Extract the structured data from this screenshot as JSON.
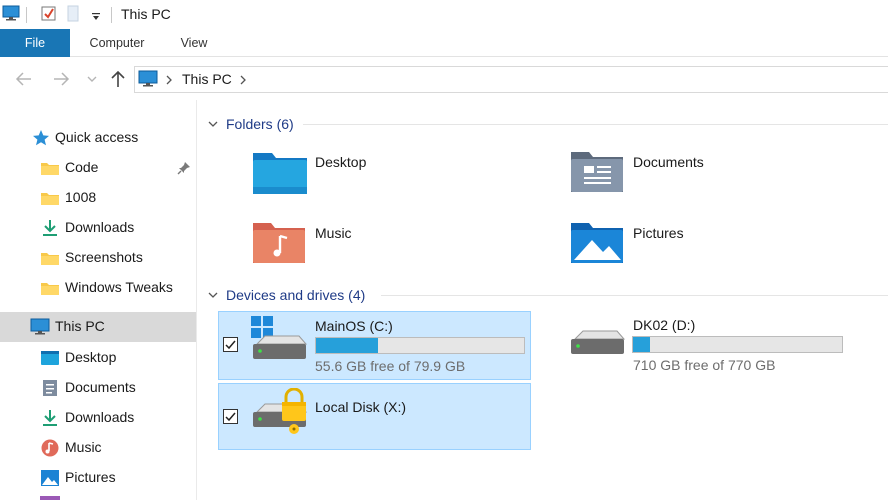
{
  "window": {
    "title": "This PC"
  },
  "ribbon": {
    "tabs": [
      {
        "label": "File"
      },
      {
        "label": "Computer"
      },
      {
        "label": "View"
      }
    ]
  },
  "address": {
    "path": "This PC"
  },
  "sidebar": {
    "quick_access_label": "Quick access",
    "quick_items": [
      {
        "label": "Code",
        "pinned": true
      },
      {
        "label": "1008"
      },
      {
        "label": "Downloads"
      },
      {
        "label": "Screenshots"
      },
      {
        "label": "Windows Tweaks"
      }
    ],
    "this_pc_label": "This PC",
    "pc_items": [
      {
        "label": "Desktop"
      },
      {
        "label": "Documents"
      },
      {
        "label": "Downloads"
      },
      {
        "label": "Music"
      },
      {
        "label": "Pictures"
      }
    ]
  },
  "folders": {
    "header": "Folders (6)",
    "items": [
      {
        "label": "Desktop"
      },
      {
        "label": "Documents"
      },
      {
        "label": "Music"
      },
      {
        "label": "Pictures"
      }
    ]
  },
  "drives": {
    "header": "Devices and drives (4)",
    "items": [
      {
        "label": "MainOS (C:)",
        "free": "55.6 GB free of 79.9 GB",
        "used_fraction": 0.3
      },
      {
        "label": "DK02 (D:)",
        "free": "710 GB free of 770 GB",
        "used_fraction": 0.08
      },
      {
        "label": "Local Disk (X:)"
      }
    ]
  },
  "colors": {
    "accent": "#1976b5",
    "selection": "#cce8ff",
    "bar_fill": "#26a0da"
  }
}
